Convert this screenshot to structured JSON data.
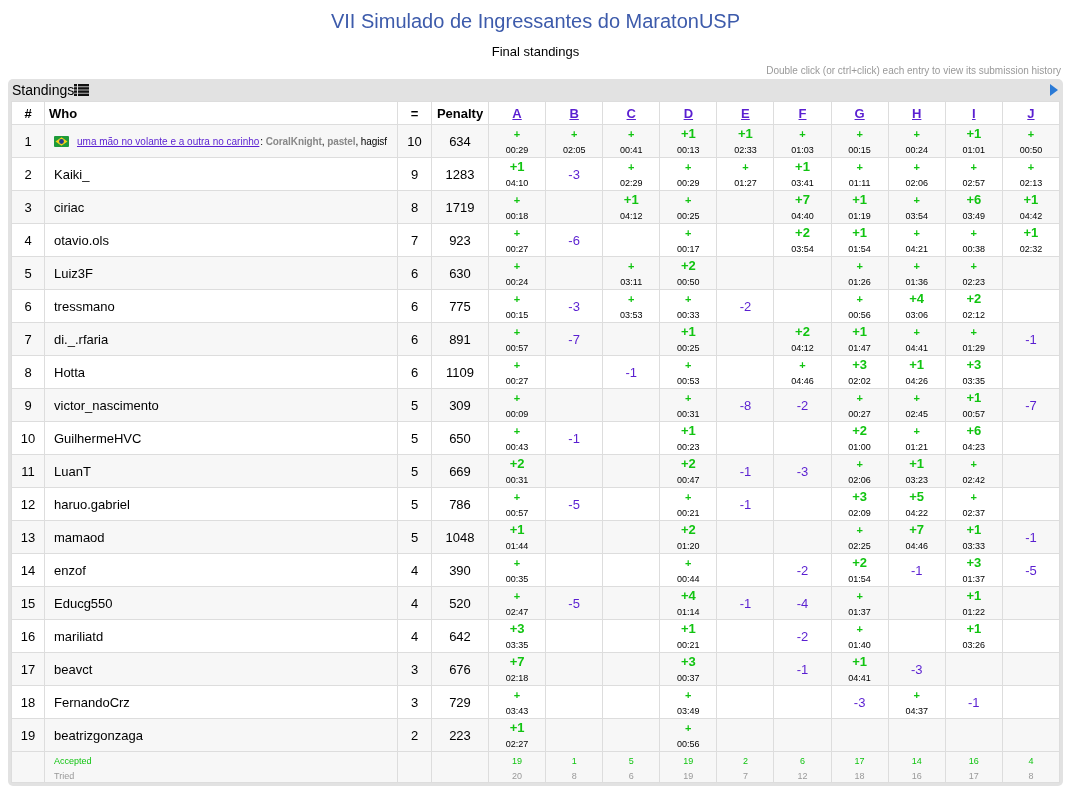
{
  "title": "VII Simulado de Ingressantes do MaratonUSP",
  "subtitle": "Final standings",
  "hint": "Double click (or ctrl+click) each entry to view its submission history",
  "panel": {
    "title": "Standings"
  },
  "columns": {
    "rank": "#",
    "who": "Who",
    "solved": "=",
    "penalty": "Penalty",
    "problems": [
      "A",
      "B",
      "C",
      "D",
      "E",
      "F",
      "G",
      "H",
      "I",
      "J"
    ]
  },
  "rows": [
    {
      "rank": "1",
      "kind": "team",
      "flag": true,
      "name": "uma mão no volante e a outra no carinho",
      "members": ": **CoralKnight**, **pastel**, hagisf",
      "solved": "10",
      "penalty": "634",
      "cells": [
        {
          "kind": "ac",
          "tries": "+",
          "time": "00:29"
        },
        {
          "kind": "ac",
          "tries": "+",
          "time": "02:05"
        },
        {
          "kind": "ac",
          "tries": "+",
          "time": "00:41"
        },
        {
          "kind": "ac",
          "tries": "+1",
          "time": "00:13"
        },
        {
          "kind": "ac",
          "tries": "+1",
          "time": "02:33"
        },
        {
          "kind": "ac",
          "tries": "+",
          "time": "01:03"
        },
        {
          "kind": "ac",
          "tries": "+",
          "time": "00:15"
        },
        {
          "kind": "ac",
          "tries": "+",
          "time": "00:24"
        },
        {
          "kind": "ac",
          "tries": "+1",
          "time": "01:01"
        },
        {
          "kind": "ac",
          "tries": "+",
          "time": "00:50"
        }
      ]
    },
    {
      "rank": "2",
      "kind": "user",
      "flag": false,
      "name": "Kaiki_",
      "solved": "9",
      "penalty": "1283",
      "cells": [
        {
          "kind": "ac",
          "tries": "+1",
          "time": "04:10"
        },
        {
          "kind": "wa",
          "tries": "-3"
        },
        {
          "kind": "ac",
          "tries": "+",
          "time": "02:29"
        },
        {
          "kind": "ac",
          "tries": "+",
          "time": "00:29"
        },
        {
          "kind": "ac",
          "tries": "+",
          "time": "01:27"
        },
        {
          "kind": "ac",
          "tries": "+1",
          "time": "03:41"
        },
        {
          "kind": "ac",
          "tries": "+",
          "time": "01:11"
        },
        {
          "kind": "ac",
          "tries": "+",
          "time": "02:06"
        },
        {
          "kind": "ac",
          "tries": "+",
          "time": "02:57"
        },
        {
          "kind": "ac",
          "tries": "+",
          "time": "02:13"
        }
      ]
    },
    {
      "rank": "3",
      "kind": "user",
      "flag": false,
      "name": "ciriac",
      "solved": "8",
      "penalty": "1719",
      "cells": [
        {
          "kind": "ac",
          "tries": "+",
          "time": "00:18"
        },
        {
          "kind": "none"
        },
        {
          "kind": "ac",
          "tries": "+1",
          "time": "04:12"
        },
        {
          "kind": "ac",
          "tries": "+",
          "time": "00:25"
        },
        {
          "kind": "none"
        },
        {
          "kind": "ac",
          "tries": "+7",
          "time": "04:40"
        },
        {
          "kind": "ac",
          "tries": "+1",
          "time": "01:19"
        },
        {
          "kind": "ac",
          "tries": "+",
          "time": "03:54"
        },
        {
          "kind": "ac",
          "tries": "+6",
          "time": "03:49"
        },
        {
          "kind": "ac",
          "tries": "+1",
          "time": "04:42"
        }
      ]
    },
    {
      "rank": "4",
      "kind": "user",
      "flag": false,
      "name": "otavio.ols",
      "solved": "7",
      "penalty": "923",
      "cells": [
        {
          "kind": "ac",
          "tries": "+",
          "time": "00:27"
        },
        {
          "kind": "wa",
          "tries": "-6"
        },
        {
          "kind": "none"
        },
        {
          "kind": "ac",
          "tries": "+",
          "time": "00:17"
        },
        {
          "kind": "none"
        },
        {
          "kind": "ac",
          "tries": "+2",
          "time": "03:54"
        },
        {
          "kind": "ac",
          "tries": "+1",
          "time": "01:54"
        },
        {
          "kind": "ac",
          "tries": "+",
          "time": "04:21"
        },
        {
          "kind": "ac",
          "tries": "+",
          "time": "00:38"
        },
        {
          "kind": "ac",
          "tries": "+1",
          "time": "02:32"
        }
      ]
    },
    {
      "rank": "5",
      "kind": "user",
      "flag": false,
      "name": "Luiz3F",
      "solved": "6",
      "penalty": "630",
      "cells": [
        {
          "kind": "ac",
          "tries": "+",
          "time": "00:24"
        },
        {
          "kind": "none"
        },
        {
          "kind": "ac",
          "tries": "+",
          "time": "03:11"
        },
        {
          "kind": "ac",
          "tries": "+2",
          "time": "00:50"
        },
        {
          "kind": "none"
        },
        {
          "kind": "none"
        },
        {
          "kind": "ac",
          "tries": "+",
          "time": "01:26"
        },
        {
          "kind": "ac",
          "tries": "+",
          "time": "01:36"
        },
        {
          "kind": "ac",
          "tries": "+",
          "time": "02:23"
        },
        {
          "kind": "none"
        }
      ]
    },
    {
      "rank": "6",
      "kind": "user",
      "flag": false,
      "name": "tressmano",
      "solved": "6",
      "penalty": "775",
      "cells": [
        {
          "kind": "ac",
          "tries": "+",
          "time": "00:15"
        },
        {
          "kind": "wa",
          "tries": "-3"
        },
        {
          "kind": "ac",
          "tries": "+",
          "time": "03:53"
        },
        {
          "kind": "ac",
          "tries": "+",
          "time": "00:33"
        },
        {
          "kind": "wa",
          "tries": "-2"
        },
        {
          "kind": "none"
        },
        {
          "kind": "ac",
          "tries": "+",
          "time": "00:56"
        },
        {
          "kind": "ac",
          "tries": "+4",
          "time": "03:06"
        },
        {
          "kind": "ac",
          "tries": "+2",
          "time": "02:12"
        },
        {
          "kind": "none"
        }
      ]
    },
    {
      "rank": "7",
      "kind": "user",
      "flag": false,
      "name": "di._.rfaria",
      "solved": "6",
      "penalty": "891",
      "cells": [
        {
          "kind": "ac",
          "tries": "+",
          "time": "00:57"
        },
        {
          "kind": "wa",
          "tries": "-7"
        },
        {
          "kind": "none"
        },
        {
          "kind": "ac",
          "tries": "+1",
          "time": "00:25"
        },
        {
          "kind": "none"
        },
        {
          "kind": "ac",
          "tries": "+2",
          "time": "04:12"
        },
        {
          "kind": "ac",
          "tries": "+1",
          "time": "01:47"
        },
        {
          "kind": "ac",
          "tries": "+",
          "time": "04:41"
        },
        {
          "kind": "ac",
          "tries": "+",
          "time": "01:29"
        },
        {
          "kind": "wa",
          "tries": "-1"
        }
      ]
    },
    {
      "rank": "8",
      "kind": "user",
      "flag": false,
      "name": "Hotta",
      "solved": "6",
      "penalty": "1109",
      "cells": [
        {
          "kind": "ac",
          "tries": "+",
          "time": "00:27"
        },
        {
          "kind": "none"
        },
        {
          "kind": "wa",
          "tries": "-1"
        },
        {
          "kind": "ac",
          "tries": "+",
          "time": "00:53"
        },
        {
          "kind": "none"
        },
        {
          "kind": "ac",
          "tries": "+",
          "time": "04:46"
        },
        {
          "kind": "ac",
          "tries": "+3",
          "time": "02:02"
        },
        {
          "kind": "ac",
          "tries": "+1",
          "time": "04:26"
        },
        {
          "kind": "ac",
          "tries": "+3",
          "time": "03:35"
        },
        {
          "kind": "none"
        }
      ]
    },
    {
      "rank": "9",
      "kind": "user",
      "flag": false,
      "name": "victor_nascimento",
      "solved": "5",
      "penalty": "309",
      "cells": [
        {
          "kind": "ac",
          "tries": "+",
          "time": "00:09"
        },
        {
          "kind": "none"
        },
        {
          "kind": "none"
        },
        {
          "kind": "ac",
          "tries": "+",
          "time": "00:31"
        },
        {
          "kind": "wa",
          "tries": "-8"
        },
        {
          "kind": "wa",
          "tries": "-2"
        },
        {
          "kind": "ac",
          "tries": "+",
          "time": "00:27"
        },
        {
          "kind": "ac",
          "tries": "+",
          "time": "02:45"
        },
        {
          "kind": "ac",
          "tries": "+1",
          "time": "00:57"
        },
        {
          "kind": "wa",
          "tries": "-7"
        }
      ]
    },
    {
      "rank": "10",
      "kind": "user",
      "flag": false,
      "name": "GuilhermeHVC",
      "solved": "5",
      "penalty": "650",
      "cells": [
        {
          "kind": "ac",
          "tries": "+",
          "time": "00:43"
        },
        {
          "kind": "wa",
          "tries": "-1"
        },
        {
          "kind": "none"
        },
        {
          "kind": "ac",
          "tries": "+1",
          "time": "00:23"
        },
        {
          "kind": "none"
        },
        {
          "kind": "none"
        },
        {
          "kind": "ac",
          "tries": "+2",
          "time": "01:00"
        },
        {
          "kind": "ac",
          "tries": "+",
          "time": "01:21"
        },
        {
          "kind": "ac",
          "tries": "+6",
          "time": "04:23"
        },
        {
          "kind": "none"
        }
      ]
    },
    {
      "rank": "11",
      "kind": "user",
      "flag": false,
      "name": "LuanT",
      "solved": "5",
      "penalty": "669",
      "cells": [
        {
          "kind": "ac",
          "tries": "+2",
          "time": "00:31"
        },
        {
          "kind": "none"
        },
        {
          "kind": "none"
        },
        {
          "kind": "ac",
          "tries": "+2",
          "time": "00:47"
        },
        {
          "kind": "wa",
          "tries": "-1"
        },
        {
          "kind": "wa",
          "tries": "-3"
        },
        {
          "kind": "ac",
          "tries": "+",
          "time": "02:06"
        },
        {
          "kind": "ac",
          "tries": "+1",
          "time": "03:23"
        },
        {
          "kind": "ac",
          "tries": "+",
          "time": "02:42"
        },
        {
          "kind": "none"
        }
      ]
    },
    {
      "rank": "12",
      "kind": "user",
      "flag": false,
      "name": "haruo.gabriel",
      "solved": "5",
      "penalty": "786",
      "cells": [
        {
          "kind": "ac",
          "tries": "+",
          "time": "00:57"
        },
        {
          "kind": "wa",
          "tries": "-5"
        },
        {
          "kind": "none"
        },
        {
          "kind": "ac",
          "tries": "+",
          "time": "00:21"
        },
        {
          "kind": "wa",
          "tries": "-1"
        },
        {
          "kind": "none"
        },
        {
          "kind": "ac",
          "tries": "+3",
          "time": "02:09"
        },
        {
          "kind": "ac",
          "tries": "+5",
          "time": "04:22"
        },
        {
          "kind": "ac",
          "tries": "+",
          "time": "02:37"
        },
        {
          "kind": "none"
        }
      ]
    },
    {
      "rank": "13",
      "kind": "user",
      "flag": false,
      "name": "mamaod",
      "solved": "5",
      "penalty": "1048",
      "cells": [
        {
          "kind": "ac",
          "tries": "+1",
          "time": "01:44"
        },
        {
          "kind": "none"
        },
        {
          "kind": "none"
        },
        {
          "kind": "ac",
          "tries": "+2",
          "time": "01:20"
        },
        {
          "kind": "none"
        },
        {
          "kind": "none"
        },
        {
          "kind": "ac",
          "tries": "+",
          "time": "02:25"
        },
        {
          "kind": "ac",
          "tries": "+7",
          "time": "04:46"
        },
        {
          "kind": "ac",
          "tries": "+1",
          "time": "03:33"
        },
        {
          "kind": "wa",
          "tries": "-1"
        }
      ]
    },
    {
      "rank": "14",
      "kind": "user",
      "flag": false,
      "name": "enzof",
      "solved": "4",
      "penalty": "390",
      "cells": [
        {
          "kind": "ac",
          "tries": "+",
          "time": "00:35"
        },
        {
          "kind": "none"
        },
        {
          "kind": "none"
        },
        {
          "kind": "ac",
          "tries": "+",
          "time": "00:44"
        },
        {
          "kind": "none"
        },
        {
          "kind": "wa",
          "tries": "-2"
        },
        {
          "kind": "ac",
          "tries": "+2",
          "time": "01:54"
        },
        {
          "kind": "wa",
          "tries": "-1"
        },
        {
          "kind": "ac",
          "tries": "+3",
          "time": "01:37"
        },
        {
          "kind": "wa",
          "tries": "-5"
        }
      ]
    },
    {
      "rank": "15",
      "kind": "user",
      "flag": false,
      "name": "Educg550",
      "solved": "4",
      "penalty": "520",
      "cells": [
        {
          "kind": "ac",
          "tries": "+",
          "time": "02:47"
        },
        {
          "kind": "wa",
          "tries": "-5"
        },
        {
          "kind": "none"
        },
        {
          "kind": "ac",
          "tries": "+4",
          "time": "01:14"
        },
        {
          "kind": "wa",
          "tries": "-1"
        },
        {
          "kind": "wa",
          "tries": "-4"
        },
        {
          "kind": "ac",
          "tries": "+",
          "time": "01:37"
        },
        {
          "kind": "none"
        },
        {
          "kind": "ac",
          "tries": "+1",
          "time": "01:22"
        },
        {
          "kind": "none"
        }
      ]
    },
    {
      "rank": "16",
      "kind": "user",
      "flag": false,
      "name": "mariliatd",
      "solved": "4",
      "penalty": "642",
      "cells": [
        {
          "kind": "ac",
          "tries": "+3",
          "time": "03:35"
        },
        {
          "kind": "none"
        },
        {
          "kind": "none"
        },
        {
          "kind": "ac",
          "tries": "+1",
          "time": "00:21"
        },
        {
          "kind": "none"
        },
        {
          "kind": "wa",
          "tries": "-2"
        },
        {
          "kind": "ac",
          "tries": "+",
          "time": "01:40"
        },
        {
          "kind": "none"
        },
        {
          "kind": "ac",
          "tries": "+1",
          "time": "03:26"
        },
        {
          "kind": "none"
        }
      ]
    },
    {
      "rank": "17",
      "kind": "user",
      "flag": false,
      "name": "beavct",
      "solved": "3",
      "penalty": "676",
      "cells": [
        {
          "kind": "ac",
          "tries": "+7",
          "time": "02:18"
        },
        {
          "kind": "none"
        },
        {
          "kind": "none"
        },
        {
          "kind": "ac",
          "tries": "+3",
          "time": "00:37"
        },
        {
          "kind": "none"
        },
        {
          "kind": "wa",
          "tries": "-1"
        },
        {
          "kind": "ac",
          "tries": "+1",
          "time": "04:41"
        },
        {
          "kind": "wa",
          "tries": "-3"
        },
        {
          "kind": "none"
        },
        {
          "kind": "none"
        }
      ]
    },
    {
      "rank": "18",
      "kind": "user",
      "flag": false,
      "name": "FernandoCrz",
      "solved": "3",
      "penalty": "729",
      "cells": [
        {
          "kind": "ac",
          "tries": "+",
          "time": "03:43"
        },
        {
          "kind": "none"
        },
        {
          "kind": "none"
        },
        {
          "kind": "ac",
          "tries": "+",
          "time": "03:49"
        },
        {
          "kind": "none"
        },
        {
          "kind": "none"
        },
        {
          "kind": "wa",
          "tries": "-3"
        },
        {
          "kind": "ac",
          "tries": "+",
          "time": "04:37"
        },
        {
          "kind": "wa",
          "tries": "-1"
        },
        {
          "kind": "none"
        }
      ]
    },
    {
      "rank": "19",
      "kind": "user",
      "flag": false,
      "name": "beatrizgonzaga",
      "solved": "2",
      "penalty": "223",
      "cells": [
        {
          "kind": "ac",
          "tries": "+1",
          "time": "02:27"
        },
        {
          "kind": "none"
        },
        {
          "kind": "none"
        },
        {
          "kind": "ac",
          "tries": "+",
          "time": "00:56"
        },
        {
          "kind": "none"
        },
        {
          "kind": "none"
        },
        {
          "kind": "none"
        },
        {
          "kind": "none"
        },
        {
          "kind": "none"
        },
        {
          "kind": "none"
        }
      ]
    }
  ],
  "footer": {
    "accepted_label": "Accepted",
    "tried_label": "Tried",
    "accepted": [
      "19",
      "1",
      "5",
      "19",
      "2",
      "6",
      "17",
      "14",
      "16",
      "4"
    ],
    "tried": [
      "20",
      "8",
      "6",
      "19",
      "7",
      "12",
      "18",
      "16",
      "17",
      "8"
    ]
  }
}
